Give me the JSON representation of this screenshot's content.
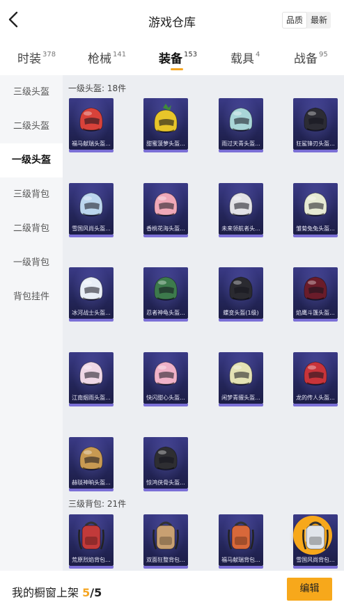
{
  "header": {
    "title": "游戏仓库",
    "sort_options": [
      "品质",
      "最新"
    ],
    "sort_active": "品质"
  },
  "tabs": [
    {
      "label": "时装",
      "count": "378"
    },
    {
      "label": "枪械",
      "count": "141"
    },
    {
      "label": "装备",
      "count": "153",
      "active": true
    },
    {
      "label": "载具",
      "count": "4"
    },
    {
      "label": "战备",
      "count": "95"
    }
  ],
  "sidebar": {
    "items": [
      {
        "label": "三级头盔"
      },
      {
        "label": "二级头盔"
      },
      {
        "label": "一级头盔",
        "active": true
      },
      {
        "label": "三级背包"
      },
      {
        "label": "二级背包"
      },
      {
        "label": "一级背包"
      },
      {
        "label": "背包挂件"
      }
    ]
  },
  "sections": [
    {
      "title": "一级头盔: 18件",
      "items": [
        {
          "name": "福马献瑞头盔...",
          "color": "#d8423a",
          "icon": "helmet-icon"
        },
        {
          "name": "甜蜜菠萝头盔...",
          "color": "#e8c52a",
          "icon": "pineapple-helmet-icon"
        },
        {
          "name": "雨过天青头盔...",
          "color": "#a9d6d8",
          "icon": "helmet-icon"
        },
        {
          "name": "狂鲨锋刃头盔...",
          "color": "#2c2c34",
          "icon": "helmet-icon"
        },
        {
          "name": "雪国风尚头盔...",
          "color": "#bcd6ee",
          "icon": "helmet-icon"
        },
        {
          "name": "香桃花海头盔...",
          "color": "#f0a8b8",
          "icon": "helmet-icon"
        },
        {
          "name": "未来领航者头...",
          "color": "#e2e2e6",
          "icon": "helmet-icon"
        },
        {
          "name": "雏菊兔兔头盔...",
          "color": "#e6ead4",
          "icon": "helmet-icon"
        },
        {
          "name": "冰河战士头盔...",
          "color": "#e8eef6",
          "icon": "helmet-icon"
        },
        {
          "name": "忍者神龟头盔...",
          "color": "#3d7a4c",
          "icon": "helmet-icon"
        },
        {
          "name": "蝶变头盔(1级)",
          "color": "#2a2a30",
          "icon": "helmet-icon"
        },
        {
          "name": "焰鹰斗篷头盔...",
          "color": "#6a1c2a",
          "icon": "helmet-icon"
        },
        {
          "name": "江南烟雨头盔...",
          "color": "#efd8e6",
          "icon": "helmet-icon"
        },
        {
          "name": "快闪甜心头盔...",
          "color": "#f0b2c8",
          "icon": "helmet-icon"
        },
        {
          "name": "闲梦青擅头盔...",
          "color": "#e4e2b4",
          "icon": "helmet-icon"
        },
        {
          "name": "龙的传人头盔...",
          "color": "#c8343a",
          "icon": "helmet-icon"
        },
        {
          "name": "赫琰神晌头盔...",
          "color": "#c89a52",
          "icon": "helmet-icon"
        },
        {
          "name": "惊鸿侠骨头盔...",
          "color": "#2e2e32",
          "icon": "helmet-icon"
        }
      ]
    },
    {
      "title": "三级背包: 21件",
      "items": [
        {
          "name": "荒原烈焰背包...",
          "color": "#c23a3a",
          "icon": "backpack-icon"
        },
        {
          "name": "双面狂整背包...",
          "color": "#c8a072",
          "icon": "backpack-icon"
        },
        {
          "name": "福马献瑞背包...",
          "color": "#d8683a",
          "icon": "backpack-icon"
        },
        {
          "name": "雪国风尚背包...",
          "color": "#e0e4ea",
          "icon": "backpack-icon"
        }
      ]
    }
  ],
  "footer": {
    "label": "我的橱窗上架",
    "count": "5",
    "separator": "/",
    "total": "5",
    "edit_label": "编辑"
  },
  "fab": {
    "icon": "share-icon"
  }
}
